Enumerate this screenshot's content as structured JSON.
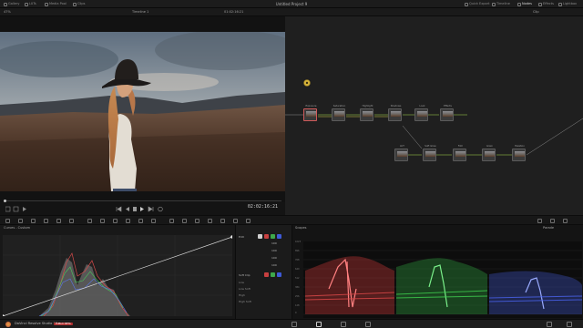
{
  "app": {
    "project_title": "Untitled Project 9",
    "status_name": "DaVinci Resolve Studio 19",
    "status_badge": "PUBLIC BETA"
  },
  "topbar": {
    "left_items": [
      "Gallery",
      "LUTs",
      "Media Pool",
      "Clips"
    ],
    "right_items": [
      "Quick Export",
      "Timeline",
      "Nodes",
      "Effects",
      "Lightbox"
    ]
  },
  "subbar": {
    "zoom": "47%",
    "timeline_name": "Timeline 1",
    "timecode_top": "01:02:16:21",
    "clip_label": "Clip"
  },
  "viewer": {
    "timecode": "02:02:16:21"
  },
  "nodes": {
    "labels": [
      "Exposure",
      "Saturation",
      "Highlight",
      "Shadows",
      "Look",
      "Effects",
      "LUT",
      "Soft Glow",
      "Film",
      "Grain",
      "Halation"
    ]
  },
  "curves": {
    "title": "Curves - Custom"
  },
  "edit": {
    "title": "Edit",
    "channel_values": [
      "100",
      "100",
      "100",
      "100"
    ],
    "soft_clip_label": "Soft Clip",
    "rows": [
      "Low",
      "Low Soft",
      "High",
      "High Soft"
    ]
  },
  "scopes": {
    "title": "Scopes",
    "mode": "Parade",
    "scale": [
      "1023",
      "896",
      "768",
      "640",
      "512",
      "384",
      "256",
      "128",
      "0"
    ]
  },
  "colors": {
    "accent": "#d6b43a",
    "red_trace": "#e23a3a",
    "green_trace": "#35d14a",
    "blue_trace": "#4a63f0",
    "node_link": "#a7d94a"
  }
}
